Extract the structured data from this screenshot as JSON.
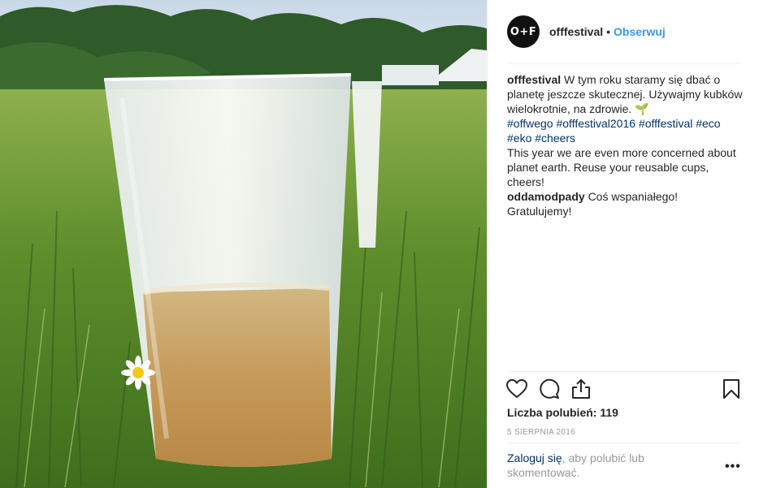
{
  "post": {
    "image_alt": "Plastic reusable cup with beer on grass",
    "header": {
      "avatar_text": "O+F",
      "username": "offfestival",
      "separator": "•",
      "follow_label": "Obserwuj"
    },
    "caption": {
      "username": "offfestival",
      "text_pl": "W tym roku staramy się dbać o planetę jeszcze skutecznej. Używajmy kubków wielokrotnie, na zdrowie.",
      "emoji": "🌱",
      "hashtags": [
        "#offwego",
        "#offfestival2016",
        "#offfestival",
        "#eco",
        "#eko",
        "#cheers"
      ],
      "text_en": "This year we are even more concerned about planet earth. Reuse your reusable cups, cheers!"
    },
    "comment": {
      "username": "oddamodpady",
      "text": "Coś wspaniałego! Gratulujemy!"
    },
    "actions": {
      "like_icon": "heart-outline",
      "comment_icon": "speech-bubble",
      "share_icon": "share-upload",
      "save_icon": "bookmark"
    },
    "likes_text": "Liczba polubień: 119",
    "date": "5 SIERPNIA 2016",
    "login_prompt": {
      "link": "Zaloguj się",
      "rest": ", aby polubić lub skomentować."
    },
    "more_label": "•••",
    "colors": {
      "link_blue": "#3897f0",
      "hashtag": "#003569",
      "muted": "#999999",
      "divider": "#efefef"
    }
  }
}
